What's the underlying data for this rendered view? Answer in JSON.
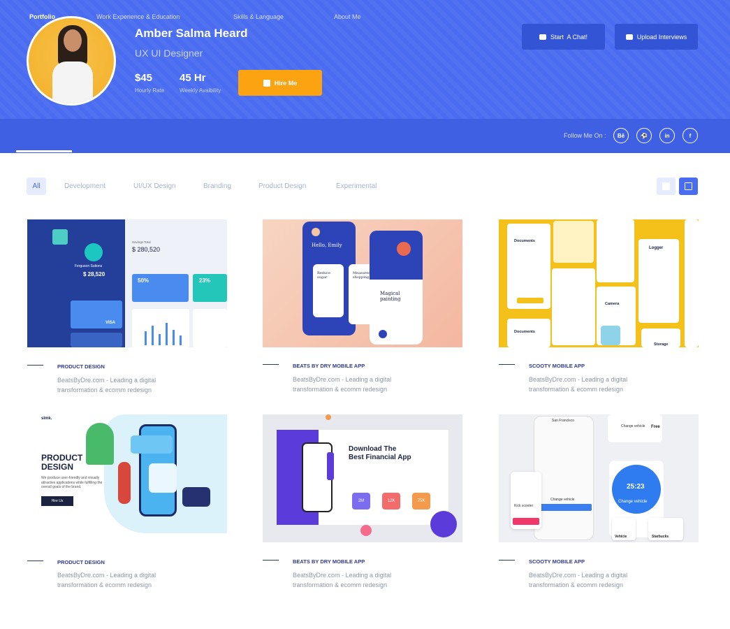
{
  "profile": {
    "name": "Amber Salma Heard",
    "role": "UX UI Designer",
    "rate_value": "$45",
    "rate_label": "Hourly Rate",
    "hours_value": "45 Hr",
    "hours_label": "Weekly Avaibility",
    "hire_label": "Hire Me"
  },
  "actions": {
    "chat_label": "Start  A Chat!",
    "upload_label": "Upload Interviews"
  },
  "nav": {
    "items": [
      {
        "label": "Portfolio"
      },
      {
        "label": "Work Experience & Education"
      },
      {
        "label": "Skills & Language"
      },
      {
        "label": "About Me"
      }
    ],
    "follow_label": "Follow Me On :",
    "social": [
      {
        "icon": "behance-icon",
        "glyph": "Bē"
      },
      {
        "icon": "dribbble-icon",
        "glyph": "⚽"
      },
      {
        "icon": "linkedin-icon",
        "glyph": "in"
      },
      {
        "icon": "facebook-icon",
        "glyph": "f"
      }
    ]
  },
  "filters": [
    "All",
    "Development",
    "UI/UX Design",
    "Branding",
    "Product Design",
    "Experimental"
  ],
  "view_icons": [
    "grid-view-icon",
    "list-view-icon"
  ],
  "thumbs": {
    "t1_small": "Savings Total",
    "t1_amount": "$ 280,520",
    "t1_name": "Ferguson Sutions",
    "t1_balance": "$ 28,520",
    "t1_p1": "50%",
    "t1_p2": "23%",
    "t1_card": "VISA",
    "t2_greet": "Hello, Emily",
    "t2_card1": "Reduce sugar",
    "t2_card2": "Measured shopping",
    "t2_paint": "Magical painting",
    "t3_docs": "Documents",
    "t3_logger": "Logger",
    "t3_camera": "Camera",
    "t3_storage": "Storage",
    "t4_brand": "slmk.",
    "t4_title1": "PRODUCT",
    "t4_title2": "DESIGN",
    "t4_body": "We produce user-friendly and visually attractive applications while fulfilling the overall goals of the brand.",
    "t4_btn": "Hire Us",
    "t5_title1": "Download The",
    "t5_title2": "Best Financial App",
    "t5_s1": "2M",
    "t5_s2": "12K",
    "t5_s3": "75K",
    "t6_city": "San Francisco",
    "t6_change": "Change vehicle",
    "t6_free": "Free",
    "t6_time": "25:23",
    "t6_kick": "Kick scooter",
    "t6_vehicle": "Vehicle",
    "t6_starbucks": "Starbucks"
  },
  "cards": [
    {
      "category": "PRODUCT DESIGN",
      "desc1": "BeatsByDre.com - Leading a digital",
      "desc2": "transformation & ecomm redesign"
    },
    {
      "category": "BEATS BY DRY MOBILE APP",
      "desc1": "BeatsByDre.com - Leading a digital",
      "desc2": "transformation & ecomm redesign"
    },
    {
      "category": "SCOOTY MOBILE APP",
      "desc1": "BeatsByDre.com - Leading a digital",
      "desc2": "transformation & ecomm redesign"
    },
    {
      "category": "PRODUCT DESIGN",
      "desc1": "BeatsByDre.com - Leading a digital",
      "desc2": "transformation & ecomm redesign"
    },
    {
      "category": "BEATS BY DRY MOBILE APP",
      "desc1": "BeatsByDre.com - Leading a digital",
      "desc2": "transformation & ecomm redesign"
    },
    {
      "category": "SCOOTY MOBILE APP",
      "desc1": "BeatsByDre.com - Leading a digital",
      "desc2": "transformation & ecomm redesign"
    }
  ],
  "colors": {
    "header": "#4a6cf0",
    "nav": "#3f60e3",
    "accent": "#fca311",
    "button_dark": "#3454d6"
  }
}
